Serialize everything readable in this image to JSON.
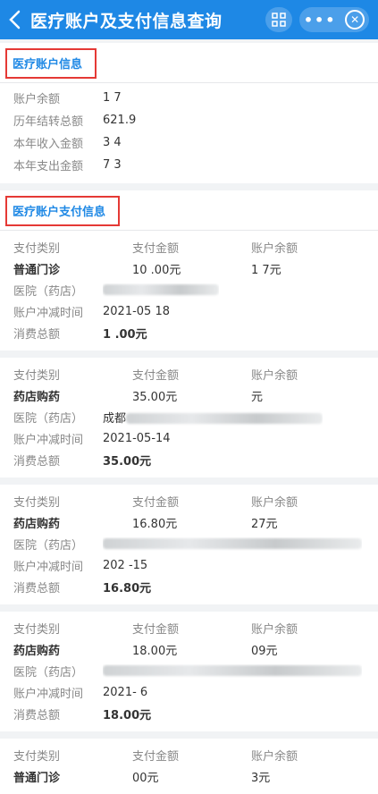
{
  "header": {
    "title": "医疗账户及支付信息查询",
    "back_icon": "chevron-left-icon",
    "scan_icon": "scan-icon",
    "more_label": "•••",
    "close_icon": "close-circle-icon"
  },
  "account": {
    "title": "医疗账户信息",
    "rows": [
      {
        "label": "账户余额",
        "value": "1   7"
      },
      {
        "label": "历年结转总额",
        "value": "621.9"
      },
      {
        "label": "本年收入金额",
        "value": "3   4"
      },
      {
        "label": "本年支出金额",
        "value": "7  3"
      }
    ]
  },
  "payments": {
    "title": "医疗账户支付信息",
    "col_headers": [
      "支付类别",
      "支付金额",
      "账户余额"
    ],
    "detail_labels": [
      "医院（药店）",
      "账户冲减时间",
      "消费总额"
    ],
    "items": [
      {
        "type": "普通门诊",
        "amount": "10 .00元",
        "balance": "1    7元",
        "hospital": "",
        "date": "2021-05 18",
        "total": "1  .00元"
      },
      {
        "type": "药店购药",
        "amount": "35.00元",
        "balance": "   元",
        "hospital": "成都",
        "date": "2021-05-14",
        "total": "35.00元"
      },
      {
        "type": "药店购药",
        "amount": "16.80元",
        "balance": "  27元",
        "hospital": "",
        "date": "202  -15",
        "total": "16.80元"
      },
      {
        "type": "药店购药",
        "amount": "18.00元",
        "balance": "  09元",
        "hospital": "",
        "date": "2021-  6",
        "total": "18.00元"
      },
      {
        "type": "普通门诊",
        "amount": "  00元",
        "balance": "  3元",
        "hospital": "",
        "date": "",
        "total": ""
      }
    ]
  }
}
